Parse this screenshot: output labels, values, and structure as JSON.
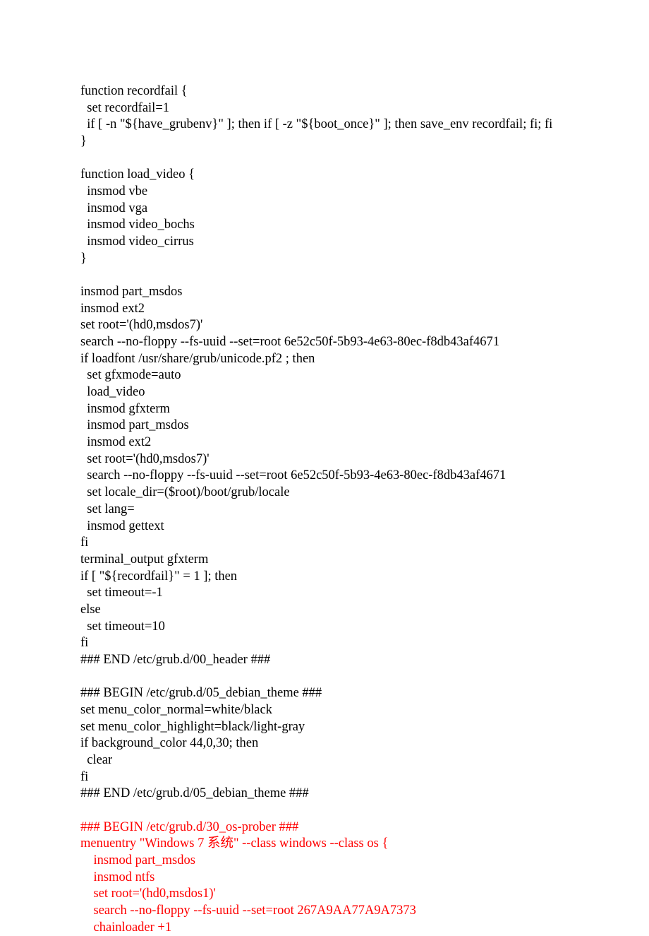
{
  "lines": [
    {
      "text": "function recordfail {",
      "color": "black"
    },
    {
      "text": "  set recordfail=1",
      "color": "black"
    },
    {
      "text": "  if [ -n \"${have_grubenv}\" ]; then if [ -z \"${boot_once}\" ]; then save_env recordfail; fi; fi",
      "color": "black"
    },
    {
      "text": "}",
      "color": "black"
    },
    {
      "text": "",
      "color": "black"
    },
    {
      "text": "function load_video {",
      "color": "black"
    },
    {
      "text": "  insmod vbe",
      "color": "black"
    },
    {
      "text": "  insmod vga",
      "color": "black"
    },
    {
      "text": "  insmod video_bochs",
      "color": "black"
    },
    {
      "text": "  insmod video_cirrus",
      "color": "black"
    },
    {
      "text": "}",
      "color": "black"
    },
    {
      "text": "",
      "color": "black"
    },
    {
      "text": "insmod part_msdos",
      "color": "black"
    },
    {
      "text": "insmod ext2",
      "color": "black"
    },
    {
      "text": "set root='(hd0,msdos7)'",
      "color": "black"
    },
    {
      "text": "search --no-floppy --fs-uuid --set=root 6e52c50f-5b93-4e63-80ec-f8db43af4671",
      "color": "black"
    },
    {
      "text": "if loadfont /usr/share/grub/unicode.pf2 ; then",
      "color": "black"
    },
    {
      "text": "  set gfxmode=auto",
      "color": "black"
    },
    {
      "text": "  load_video",
      "color": "black"
    },
    {
      "text": "  insmod gfxterm",
      "color": "black"
    },
    {
      "text": "  insmod part_msdos",
      "color": "black"
    },
    {
      "text": "  insmod ext2",
      "color": "black"
    },
    {
      "text": "  set root='(hd0,msdos7)'",
      "color": "black"
    },
    {
      "text": "  search --no-floppy --fs-uuid --set=root 6e52c50f-5b93-4e63-80ec-f8db43af4671",
      "color": "black"
    },
    {
      "text": "  set locale_dir=($root)/boot/grub/locale",
      "color": "black"
    },
    {
      "text": "  set lang=",
      "color": "black"
    },
    {
      "text": "  insmod gettext",
      "color": "black"
    },
    {
      "text": "fi",
      "color": "black"
    },
    {
      "text": "terminal_output gfxterm",
      "color": "black"
    },
    {
      "text": "if [ \"${recordfail}\" = 1 ]; then",
      "color": "black"
    },
    {
      "text": "  set timeout=-1",
      "color": "black"
    },
    {
      "text": "else",
      "color": "black"
    },
    {
      "text": "  set timeout=10",
      "color": "black"
    },
    {
      "text": "fi",
      "color": "black"
    },
    {
      "text": "### END /etc/grub.d/00_header ###",
      "color": "black"
    },
    {
      "text": "",
      "color": "black"
    },
    {
      "text": "### BEGIN /etc/grub.d/05_debian_theme ###",
      "color": "black"
    },
    {
      "text": "set menu_color_normal=white/black",
      "color": "black"
    },
    {
      "text": "set menu_color_highlight=black/light-gray",
      "color": "black"
    },
    {
      "text": "if background_color 44,0,30; then",
      "color": "black"
    },
    {
      "text": "  clear",
      "color": "black"
    },
    {
      "text": "fi",
      "color": "black"
    },
    {
      "text": "### END /etc/grub.d/05_debian_theme ###",
      "color": "black"
    },
    {
      "text": "",
      "color": "black"
    },
    {
      "text": "### BEGIN /etc/grub.d/30_os-prober ###",
      "color": "red"
    },
    {
      "text": "menuentry \"Windows 7 系统\" --class windows --class os {",
      "color": "red"
    },
    {
      "text": "    insmod part_msdos",
      "color": "red"
    },
    {
      "text": "    insmod ntfs",
      "color": "red"
    },
    {
      "text": "    set root='(hd0,msdos1)'",
      "color": "red"
    },
    {
      "text": "    search --no-floppy --fs-uuid --set=root 267A9AA77A9A7373",
      "color": "red"
    },
    {
      "text": "    chainloader +1",
      "color": "red"
    }
  ]
}
